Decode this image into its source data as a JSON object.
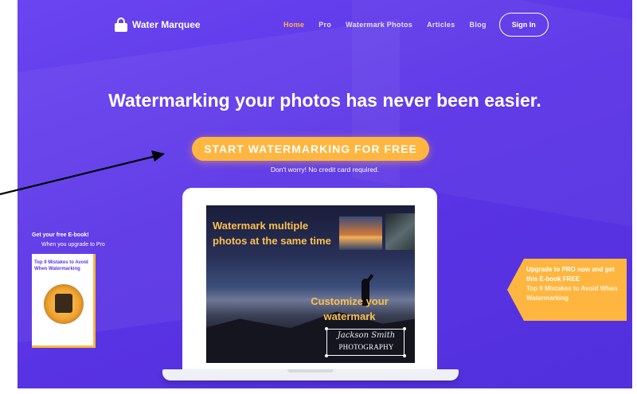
{
  "header": {
    "logo_text": "Water Marquee",
    "nav": [
      "Home",
      "Pro",
      "Watermark Photos",
      "Articles",
      "Blog"
    ],
    "signin_label": "Sign In"
  },
  "hero": {
    "headline": "Watermarking your photos has never been easier.",
    "cta_label": "START WATERMARKING FOR FREE",
    "subtext": "Don't worry! No credit card required."
  },
  "screen": {
    "title": "Watermark multiple photos at the same time",
    "customize": "Customize your watermark",
    "watermark_name": "Jackson Smith",
    "watermark_photo": "PHOTOGRAPHY"
  },
  "ebook": {
    "title": "Get your free E-book!",
    "sub": "When you upgrade to Pro",
    "cover": "Top 9 Mistakes to Avoid When Watermarking"
  },
  "banner": {
    "line1": "Upgrade to PRO now and get this E-book FREE",
    "line2": "Top 9 Mistakes to Avoid When Watermarking"
  },
  "colors": {
    "background": "#5b34e6",
    "accent": "#ffb640",
    "nav_active": "#ffb347"
  }
}
